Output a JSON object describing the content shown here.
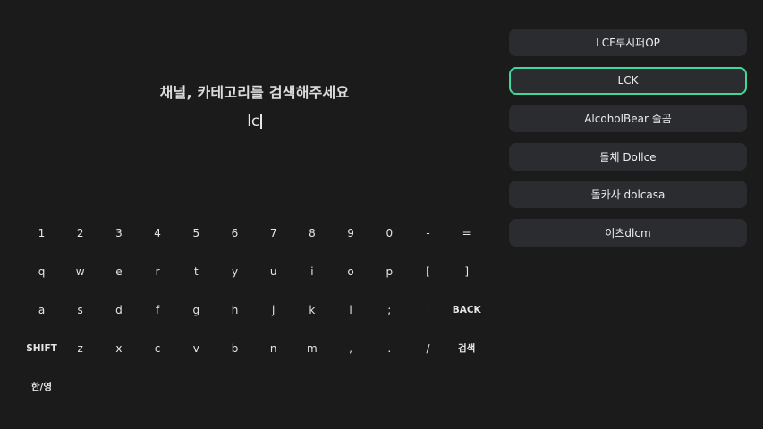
{
  "search": {
    "title": "채널, 카테고리를 검색해주세요",
    "query": "lc"
  },
  "keyboard": {
    "rows": [
      [
        "1",
        "2",
        "3",
        "4",
        "5",
        "6",
        "7",
        "8",
        "9",
        "0",
        "-",
        "="
      ],
      [
        "q",
        "w",
        "e",
        "r",
        "t",
        "y",
        "u",
        "i",
        "o",
        "p",
        "[",
        "]"
      ],
      [
        "a",
        "s",
        "d",
        "f",
        "g",
        "h",
        "j",
        "k",
        "l",
        ";",
        "'",
        "BACK"
      ],
      [
        "SHIFT",
        "z",
        "x",
        "c",
        "v",
        "b",
        "n",
        "m",
        ",",
        ".",
        "/",
        "검색"
      ],
      [
        "한/영"
      ]
    ]
  },
  "results": {
    "items": [
      {
        "label": "LCF루시퍼OP",
        "selected": false
      },
      {
        "label": "LCK",
        "selected": true
      },
      {
        "label": "AlcoholBear 술곰",
        "selected": false
      },
      {
        "label": "돌체 Dollce",
        "selected": false
      },
      {
        "label": "돌카사 dolcasa",
        "selected": false
      },
      {
        "label": "이츠dlcm",
        "selected": false
      }
    ],
    "selected_border_color": "#41d79a"
  }
}
